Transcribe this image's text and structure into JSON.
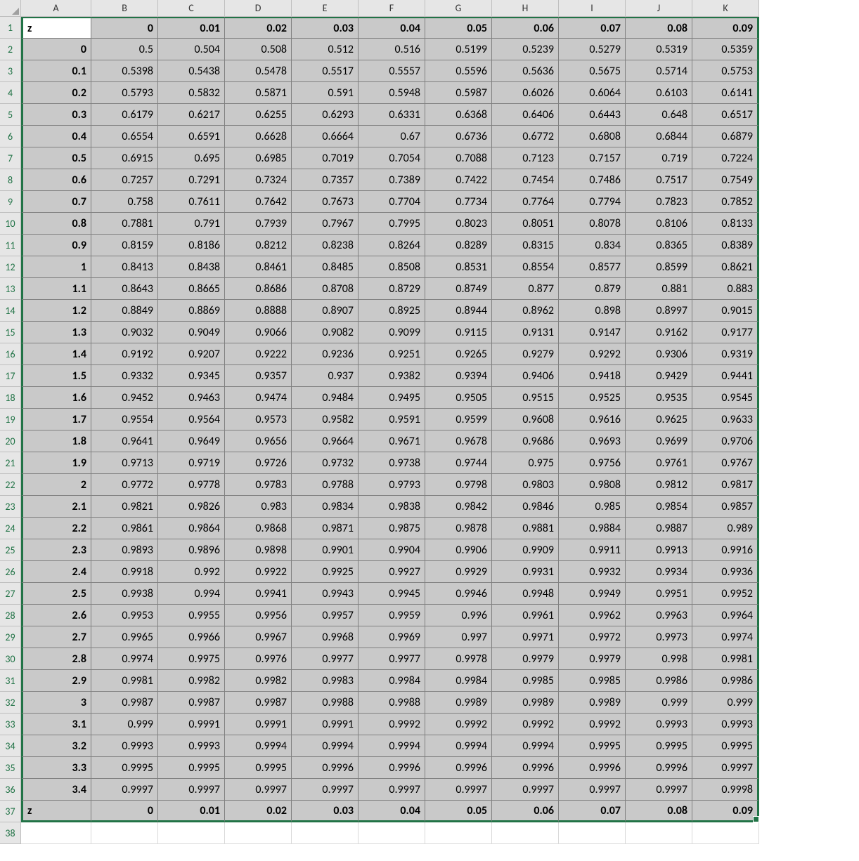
{
  "columns": [
    "A",
    "B",
    "C",
    "D",
    "E",
    "F",
    "G",
    "H",
    "I",
    "J",
    "K"
  ],
  "row_numbers": [
    1,
    2,
    3,
    4,
    5,
    6,
    7,
    8,
    9,
    10,
    11,
    12,
    13,
    14,
    15,
    16,
    17,
    18,
    19,
    20,
    21,
    22,
    23,
    24,
    25,
    26,
    27,
    28,
    29,
    30,
    31,
    32,
    33,
    34,
    35,
    36,
    37,
    38
  ],
  "header_row": {
    "label": "z",
    "values": [
      "0",
      "0.01",
      "0.02",
      "0.03",
      "0.04",
      "0.05",
      "0.06",
      "0.07",
      "0.08",
      "0.09"
    ]
  },
  "footer_row": {
    "label": "z",
    "values": [
      "0",
      "0.01",
      "0.02",
      "0.03",
      "0.04",
      "0.05",
      "0.06",
      "0.07",
      "0.08",
      "0.09"
    ]
  },
  "rows": [
    {
      "z": "0",
      "v": [
        "0.5",
        "0.504",
        "0.508",
        "0.512",
        "0.516",
        "0.5199",
        "0.5239",
        "0.5279",
        "0.5319",
        "0.5359"
      ]
    },
    {
      "z": "0.1",
      "v": [
        "0.5398",
        "0.5438",
        "0.5478",
        "0.5517",
        "0.5557",
        "0.5596",
        "0.5636",
        "0.5675",
        "0.5714",
        "0.5753"
      ]
    },
    {
      "z": "0.2",
      "v": [
        "0.5793",
        "0.5832",
        "0.5871",
        "0.591",
        "0.5948",
        "0.5987",
        "0.6026",
        "0.6064",
        "0.6103",
        "0.6141"
      ]
    },
    {
      "z": "0.3",
      "v": [
        "0.6179",
        "0.6217",
        "0.6255",
        "0.6293",
        "0.6331",
        "0.6368",
        "0.6406",
        "0.6443",
        "0.648",
        "0.6517"
      ]
    },
    {
      "z": "0.4",
      "v": [
        "0.6554",
        "0.6591",
        "0.6628",
        "0.6664",
        "0.67",
        "0.6736",
        "0.6772",
        "0.6808",
        "0.6844",
        "0.6879"
      ]
    },
    {
      "z": "0.5",
      "v": [
        "0.6915",
        "0.695",
        "0.6985",
        "0.7019",
        "0.7054",
        "0.7088",
        "0.7123",
        "0.7157",
        "0.719",
        "0.7224"
      ]
    },
    {
      "z": "0.6",
      "v": [
        "0.7257",
        "0.7291",
        "0.7324",
        "0.7357",
        "0.7389",
        "0.7422",
        "0.7454",
        "0.7486",
        "0.7517",
        "0.7549"
      ]
    },
    {
      "z": "0.7",
      "v": [
        "0.758",
        "0.7611",
        "0.7642",
        "0.7673",
        "0.7704",
        "0.7734",
        "0.7764",
        "0.7794",
        "0.7823",
        "0.7852"
      ]
    },
    {
      "z": "0.8",
      "v": [
        "0.7881",
        "0.791",
        "0.7939",
        "0.7967",
        "0.7995",
        "0.8023",
        "0.8051",
        "0.8078",
        "0.8106",
        "0.8133"
      ]
    },
    {
      "z": "0.9",
      "v": [
        "0.8159",
        "0.8186",
        "0.8212",
        "0.8238",
        "0.8264",
        "0.8289",
        "0.8315",
        "0.834",
        "0.8365",
        "0.8389"
      ]
    },
    {
      "z": "1",
      "v": [
        "0.8413",
        "0.8438",
        "0.8461",
        "0.8485",
        "0.8508",
        "0.8531",
        "0.8554",
        "0.8577",
        "0.8599",
        "0.8621"
      ]
    },
    {
      "z": "1.1",
      "v": [
        "0.8643",
        "0.8665",
        "0.8686",
        "0.8708",
        "0.8729",
        "0.8749",
        "0.877",
        "0.879",
        "0.881",
        "0.883"
      ]
    },
    {
      "z": "1.2",
      "v": [
        "0.8849",
        "0.8869",
        "0.8888",
        "0.8907",
        "0.8925",
        "0.8944",
        "0.8962",
        "0.898",
        "0.8997",
        "0.9015"
      ]
    },
    {
      "z": "1.3",
      "v": [
        "0.9032",
        "0.9049",
        "0.9066",
        "0.9082",
        "0.9099",
        "0.9115",
        "0.9131",
        "0.9147",
        "0.9162",
        "0.9177"
      ]
    },
    {
      "z": "1.4",
      "v": [
        "0.9192",
        "0.9207",
        "0.9222",
        "0.9236",
        "0.9251",
        "0.9265",
        "0.9279",
        "0.9292",
        "0.9306",
        "0.9319"
      ]
    },
    {
      "z": "1.5",
      "v": [
        "0.9332",
        "0.9345",
        "0.9357",
        "0.937",
        "0.9382",
        "0.9394",
        "0.9406",
        "0.9418",
        "0.9429",
        "0.9441"
      ]
    },
    {
      "z": "1.6",
      "v": [
        "0.9452",
        "0.9463",
        "0.9474",
        "0.9484",
        "0.9495",
        "0.9505",
        "0.9515",
        "0.9525",
        "0.9535",
        "0.9545"
      ]
    },
    {
      "z": "1.7",
      "v": [
        "0.9554",
        "0.9564",
        "0.9573",
        "0.9582",
        "0.9591",
        "0.9599",
        "0.9608",
        "0.9616",
        "0.9625",
        "0.9633"
      ]
    },
    {
      "z": "1.8",
      "v": [
        "0.9641",
        "0.9649",
        "0.9656",
        "0.9664",
        "0.9671",
        "0.9678",
        "0.9686",
        "0.9693",
        "0.9699",
        "0.9706"
      ]
    },
    {
      "z": "1.9",
      "v": [
        "0.9713",
        "0.9719",
        "0.9726",
        "0.9732",
        "0.9738",
        "0.9744",
        "0.975",
        "0.9756",
        "0.9761",
        "0.9767"
      ]
    },
    {
      "z": "2",
      "v": [
        "0.9772",
        "0.9778",
        "0.9783",
        "0.9788",
        "0.9793",
        "0.9798",
        "0.9803",
        "0.9808",
        "0.9812",
        "0.9817"
      ]
    },
    {
      "z": "2.1",
      "v": [
        "0.9821",
        "0.9826",
        "0.983",
        "0.9834",
        "0.9838",
        "0.9842",
        "0.9846",
        "0.985",
        "0.9854",
        "0.9857"
      ]
    },
    {
      "z": "2.2",
      "v": [
        "0.9861",
        "0.9864",
        "0.9868",
        "0.9871",
        "0.9875",
        "0.9878",
        "0.9881",
        "0.9884",
        "0.9887",
        "0.989"
      ]
    },
    {
      "z": "2.3",
      "v": [
        "0.9893",
        "0.9896",
        "0.9898",
        "0.9901",
        "0.9904",
        "0.9906",
        "0.9909",
        "0.9911",
        "0.9913",
        "0.9916"
      ]
    },
    {
      "z": "2.4",
      "v": [
        "0.9918",
        "0.992",
        "0.9922",
        "0.9925",
        "0.9927",
        "0.9929",
        "0.9931",
        "0.9932",
        "0.9934",
        "0.9936"
      ]
    },
    {
      "z": "2.5",
      "v": [
        "0.9938",
        "0.994",
        "0.9941",
        "0.9943",
        "0.9945",
        "0.9946",
        "0.9948",
        "0.9949",
        "0.9951",
        "0.9952"
      ]
    },
    {
      "z": "2.6",
      "v": [
        "0.9953",
        "0.9955",
        "0.9956",
        "0.9957",
        "0.9959",
        "0.996",
        "0.9961",
        "0.9962",
        "0.9963",
        "0.9964"
      ]
    },
    {
      "z": "2.7",
      "v": [
        "0.9965",
        "0.9966",
        "0.9967",
        "0.9968",
        "0.9969",
        "0.997",
        "0.9971",
        "0.9972",
        "0.9973",
        "0.9974"
      ]
    },
    {
      "z": "2.8",
      "v": [
        "0.9974",
        "0.9975",
        "0.9976",
        "0.9977",
        "0.9977",
        "0.9978",
        "0.9979",
        "0.9979",
        "0.998",
        "0.9981"
      ]
    },
    {
      "z": "2.9",
      "v": [
        "0.9981",
        "0.9982",
        "0.9982",
        "0.9983",
        "0.9984",
        "0.9984",
        "0.9985",
        "0.9985",
        "0.9986",
        "0.9986"
      ]
    },
    {
      "z": "3",
      "v": [
        "0.9987",
        "0.9987",
        "0.9987",
        "0.9988",
        "0.9988",
        "0.9989",
        "0.9989",
        "0.9989",
        "0.999",
        "0.999"
      ]
    },
    {
      "z": "3.1",
      "v": [
        "0.999",
        "0.9991",
        "0.9991",
        "0.9991",
        "0.9992",
        "0.9992",
        "0.9992",
        "0.9992",
        "0.9993",
        "0.9993"
      ]
    },
    {
      "z": "3.2",
      "v": [
        "0.9993",
        "0.9993",
        "0.9994",
        "0.9994",
        "0.9994",
        "0.9994",
        "0.9994",
        "0.9995",
        "0.9995",
        "0.9995"
      ]
    },
    {
      "z": "3.3",
      "v": [
        "0.9995",
        "0.9995",
        "0.9995",
        "0.9996",
        "0.9996",
        "0.9996",
        "0.9996",
        "0.9996",
        "0.9996",
        "0.9997"
      ]
    },
    {
      "z": "3.4",
      "v": [
        "0.9997",
        "0.9997",
        "0.9997",
        "0.9997",
        "0.9997",
        "0.9997",
        "0.9997",
        "0.9997",
        "0.9997",
        "0.9998"
      ]
    }
  ]
}
